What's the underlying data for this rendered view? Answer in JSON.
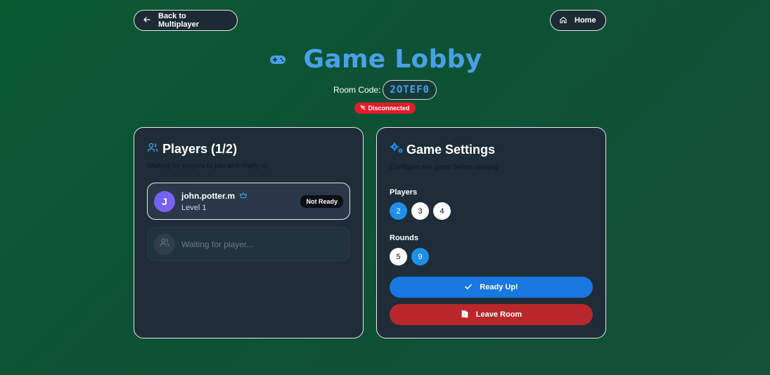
{
  "nav": {
    "back_label": "Back to Multiplayer",
    "home_label": "Home"
  },
  "header": {
    "title": "Game Lobby",
    "room_code_label": "Room Code:",
    "room_code": "2OTEF0",
    "status": "Disconnected",
    "accent_color": "#4aa0e8"
  },
  "players_panel": {
    "title": "Players (1/2)",
    "subtitle": "Waiting for players to join and ready up",
    "players": [
      {
        "initial": "J",
        "name": "john.potter.m",
        "level": "Level 1",
        "status": "Not Ready",
        "is_host": true
      }
    ],
    "waiting_text": "Waiting for player..."
  },
  "settings_panel": {
    "title": "Game Settings",
    "subtitle": "Configure the game before starting",
    "players_label": "Players",
    "player_options": [
      "2",
      "3",
      "4"
    ],
    "players_selected": "2",
    "rounds_label": "Rounds",
    "round_options": [
      "5",
      "9"
    ],
    "rounds_selected": "9",
    "ready_label": "Ready Up!",
    "leave_label": "Leave Room"
  }
}
